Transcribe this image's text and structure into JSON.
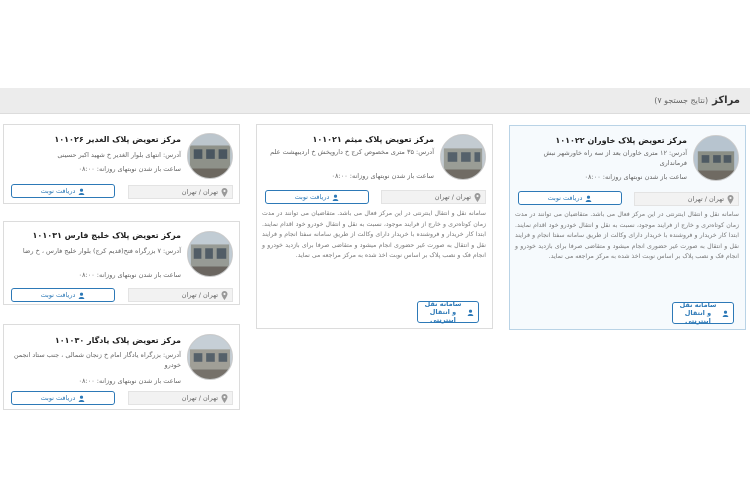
{
  "header": {
    "title": "مراکز",
    "subtitle": "(نتایج جستجو ۷)"
  },
  "cards": [
    {
      "title": "مرکز تعویض پلاک خاوران ۱۰۱۰۲۲",
      "address": "آدرس: ۱۲ متری خاوران بعد از سه راه خاورشهر نبش فرمانداری",
      "hours": "ساعت باز شدن نوبتهای روزانه: ۰۸:۰۰",
      "city": "تهران / تهران",
      "button": "دریافت نوبت",
      "description": "سامانه نقل و انتقال اینترنتی در این مرکز فعال می باشد. متقاضیان می توانند در مدت زمان کوتاه‌تری و خارج از فرایند موجود، نسبت به نقل و انتقال خودرو خود اقدام نمایند. ابتدا کار خریدار و فروشنده با خریدار دارای وکالت از طریق سامانه سفتا انجام و فرایند نقل و انتقال به صورت غیر حضوری انجام میشود و متقاضی صرفا برای بازدید خودرو و انجام فک و نصب پلاک بر اساس نوبت اخذ شده به مرکز مراجعه می نماید.",
      "system_button": "سامانه نقل و انتقال اینترنتی"
    },
    {
      "title": "مرکز تعویض پلاک میثم ۱۰۱۰۲۱",
      "address": "آدرس: ۳۵ متری مخصوص کرج خ داروپخش خ اردیبهشت علم",
      "hours": "ساعت باز شدن نوبتهای روزانه: ۰۸:۰۰",
      "city": "تهران / تهران",
      "button": "دریافت نوبت",
      "description": "سامانه نقل و انتقال اینترنتی در این مرکز فعال می باشد. متقاضیان می توانند در مدت زمان کوتاه‌تری و خارج از فرایند موجود، نسبت به نقل و انتقال خودرو خود اقدام نمایند. ابتدا کار خریدار و فروشنده با خریدار دارای وکالت از طریق سامانه سفتا انجام و فرایند نقل و انتقال به صورت غیر حضوری انجام میشود و متقاضی صرفا برای بازدید خودرو و انجام فک و نصب پلاک بر اساس نوبت اخذ شده به مرکز مراجعه می نماید.",
      "system_button": "سامانه نقل و انتقال اینترنتی"
    },
    {
      "title": "مرکز تعویض پلاک الغدیر ۱۰۱۰۲۶",
      "address": "آدرس: انتهای بلوار الغدیر خ شهید اکبر حسینی",
      "hours": "ساعت باز شدن نوبتهای روزانه: ۰۸:۰۰",
      "city": "تهران / تهران",
      "button": "دریافت نوبت"
    },
    {
      "title": "مرکز تعویض پلاک خلیج فارس ۱۰۱۰۳۱",
      "address": "آدرس: ۷ بزرگراه فتح(قدیم کرج) بلوار خلیج فارس ، خ رضا",
      "hours": "ساعت باز شدن نوبتهای روزانه: ۰۸:۰۰",
      "city": "تهران / تهران",
      "button": "دریافت نوبت"
    },
    {
      "title": "مرکز تعویض پلاک یادگار ۱۰۱۰۳۰",
      "address": "آدرس: بزرگراه یادگار امام خ زنجان شمالی ، جنب ستاد انجمن خودرو",
      "hours": "ساعت باز شدن نوبتهای روزانه: ۰۸:۰۰",
      "city": "تهران / تهران",
      "button": "دریافت نوبت"
    }
  ],
  "colors": {
    "accent": "#2d79b7",
    "selected_border": "#b9d3e6",
    "header_bg": "#ececec"
  }
}
